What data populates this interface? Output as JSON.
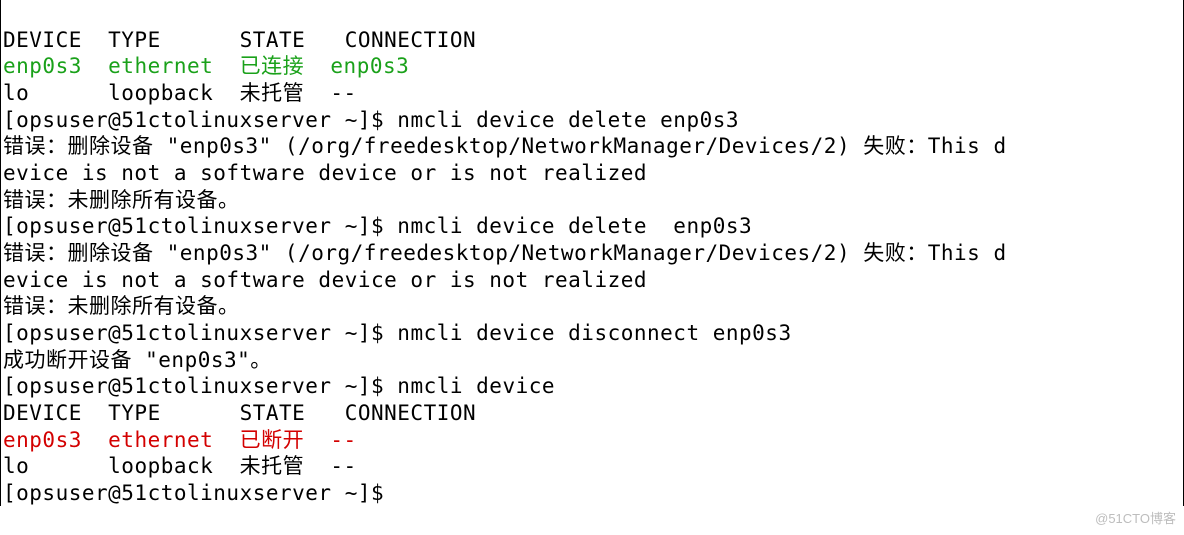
{
  "header1": {
    "line": "DEVICE  TYPE      STATE   CONNECTION"
  },
  "row1": {
    "device": "enp0s3",
    "type": "ethernet",
    "state": "已连接",
    "conn": "enp0s3"
  },
  "row2": {
    "device": "lo",
    "type": "loopback",
    "state": "未托管",
    "conn": "--"
  },
  "prompt": "[opsuser@51ctolinuxserver ~]$ ",
  "cmd1": "nmcli device delete enp0s3",
  "err1a": "错误：删除设备 \"enp0s3\" (/org/freedesktop/NetworkManager/Devices/2) 失败：This d",
  "err1b": "evice is not a software device or is not realized",
  "err1c": "错误：未删除所有设备。",
  "cmd2": "nmcli device delete  enp0s3",
  "err2a": "错误：删除设备 \"enp0s3\" (/org/freedesktop/NetworkManager/Devices/2) 失败：This d",
  "err2b": "evice is not a software device or is not realized",
  "err2c": "错误：未删除所有设备。",
  "cmd3": "nmcli device disconnect enp0s3",
  "ok3": "成功断开设备 \"enp0s3\"。",
  "cmd4": "nmcli device",
  "header2": {
    "line": "DEVICE  TYPE      STATE   CONNECTION"
  },
  "row3": {
    "device": "enp0s3",
    "type": "ethernet",
    "state": "已断开",
    "conn": "--"
  },
  "row4": {
    "device": "lo",
    "type": "loopback",
    "state": "未托管",
    "conn": "--"
  },
  "prompt_end": "[opsuser@51ctolinuxserver ~]$ ",
  "watermark": "@51CTO博客",
  "chart_data": {
    "type": "table",
    "title": "nmcli device output (before and after disconnect)",
    "before": {
      "columns": [
        "DEVICE",
        "TYPE",
        "STATE",
        "CONNECTION"
      ],
      "rows": [
        [
          "enp0s3",
          "ethernet",
          "已连接",
          "enp0s3"
        ],
        [
          "lo",
          "loopback",
          "未托管",
          "--"
        ]
      ]
    },
    "after": {
      "columns": [
        "DEVICE",
        "TYPE",
        "STATE",
        "CONNECTION"
      ],
      "rows": [
        [
          "enp0s3",
          "ethernet",
          "已断开",
          "--"
        ],
        [
          "lo",
          "loopback",
          "未托管",
          "--"
        ]
      ]
    }
  }
}
